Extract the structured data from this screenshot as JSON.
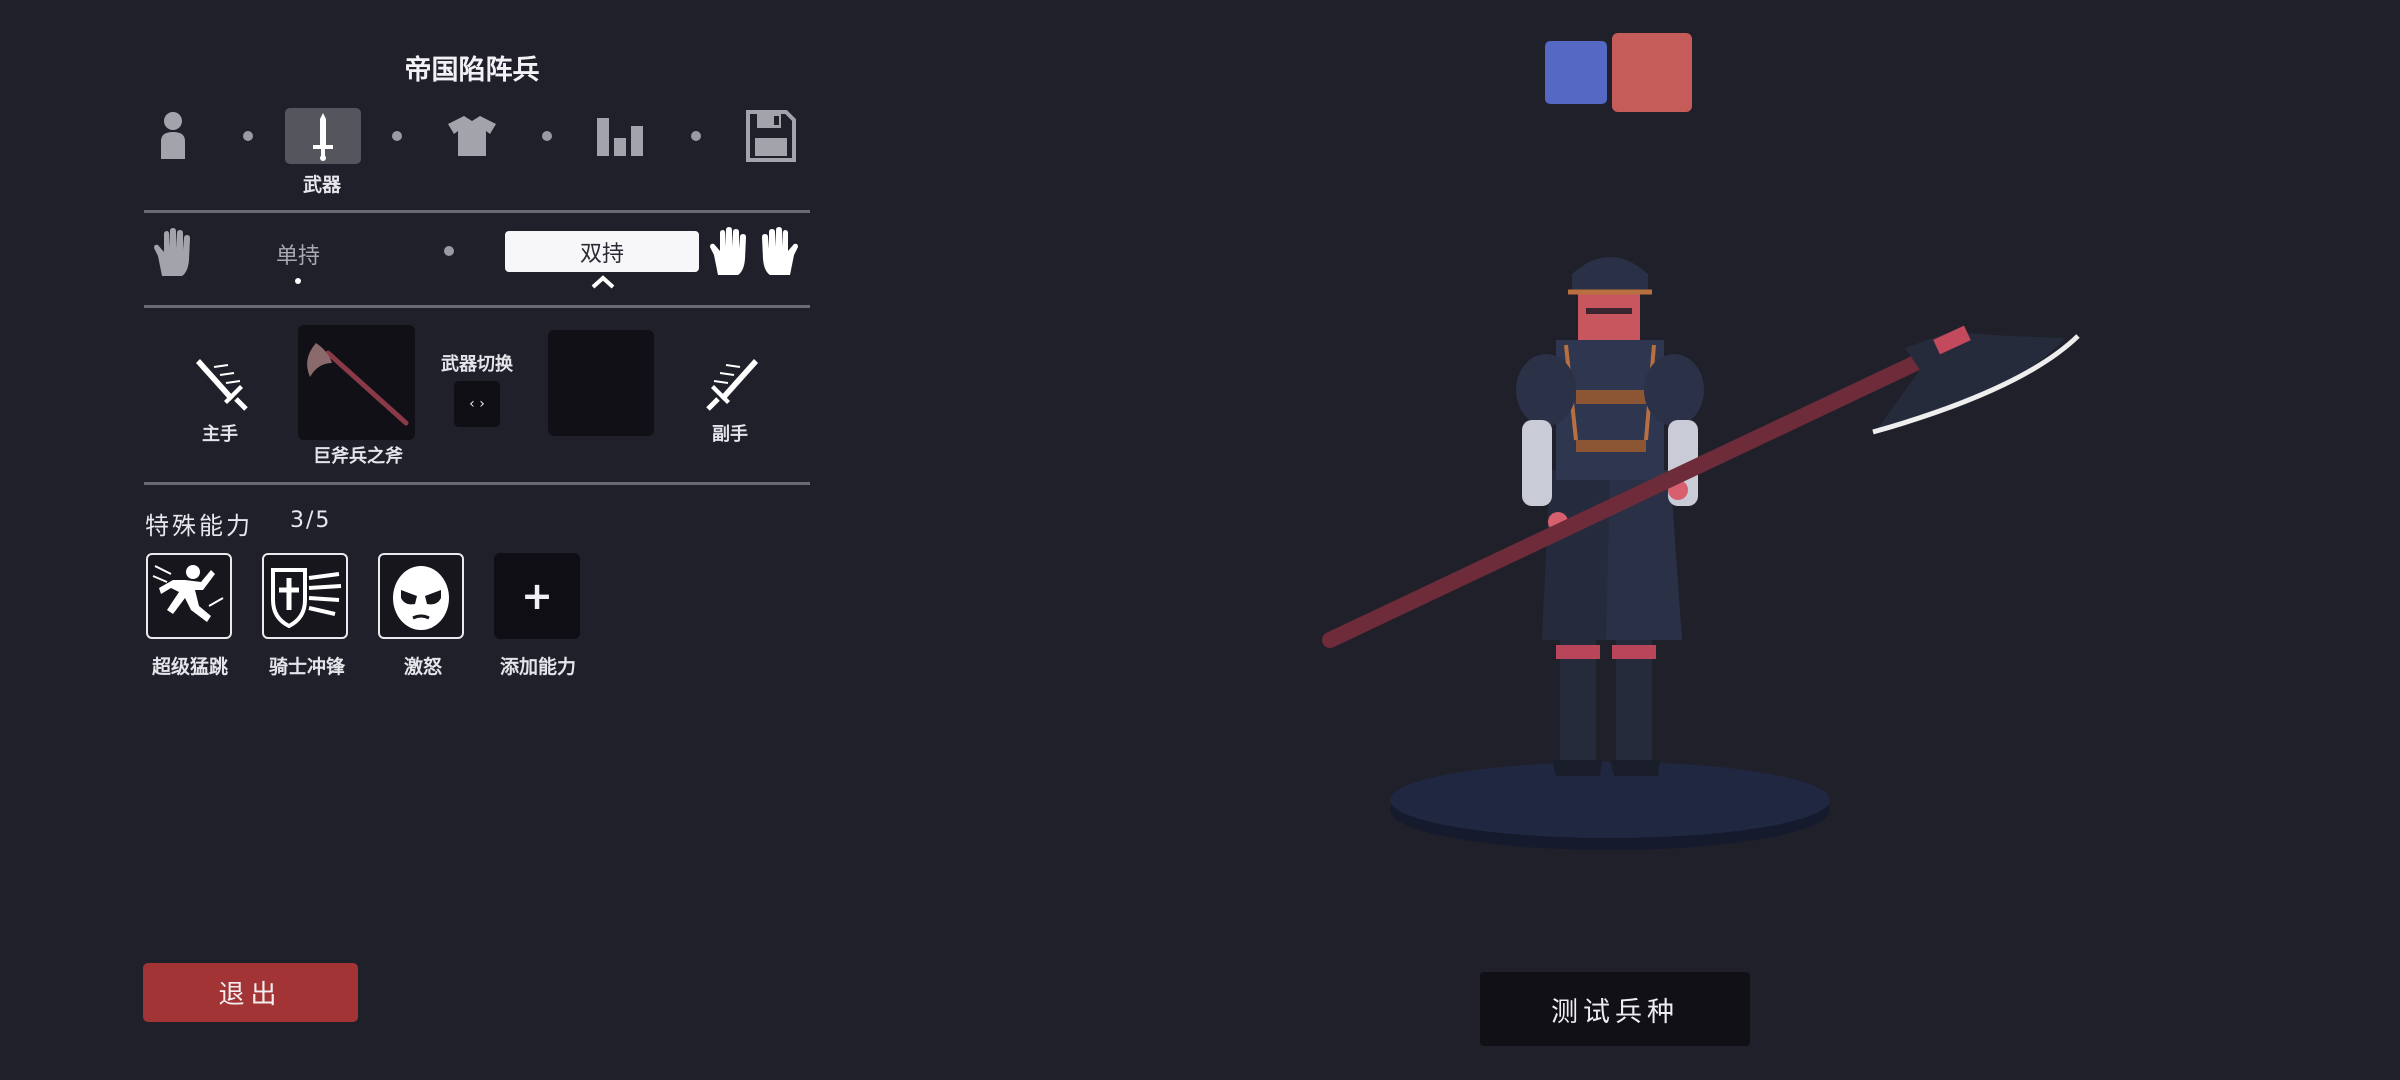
{
  "unit_name": "帝国陷阵兵",
  "tabs": [
    {
      "id": "unit",
      "icon": "person-icon"
    },
    {
      "id": "weapons",
      "icon": "sword-icon",
      "label": "武器",
      "active": true
    },
    {
      "id": "clothing",
      "icon": "shirt-icon"
    },
    {
      "id": "stats",
      "icon": "bar-chart-icon"
    },
    {
      "id": "save",
      "icon": "floppy-disk-icon"
    }
  ],
  "grip": {
    "one_handed": "单持",
    "two_handed": "双持",
    "selected": "双持"
  },
  "weapons": {
    "main_hand_label": "主手",
    "main_weapon_name": "巨斧兵之斧",
    "switch_label": "武器切换",
    "switch_icon": "‹ ›",
    "off_hand_label": "副手"
  },
  "abilities": {
    "title": "特殊能力",
    "count": "3/5",
    "items": [
      {
        "label": "超级猛跳",
        "icon": "super-jump-icon"
      },
      {
        "label": "骑士冲锋",
        "icon": "knight-charge-icon"
      },
      {
        "label": "激怒",
        "icon": "enrage-icon"
      }
    ],
    "add_label": "添加能力",
    "add_symbol": "+"
  },
  "exit_label": "退出",
  "test_label": "测试兵种",
  "team_colors": [
    "#5568c4",
    "#c65c5a"
  ]
}
